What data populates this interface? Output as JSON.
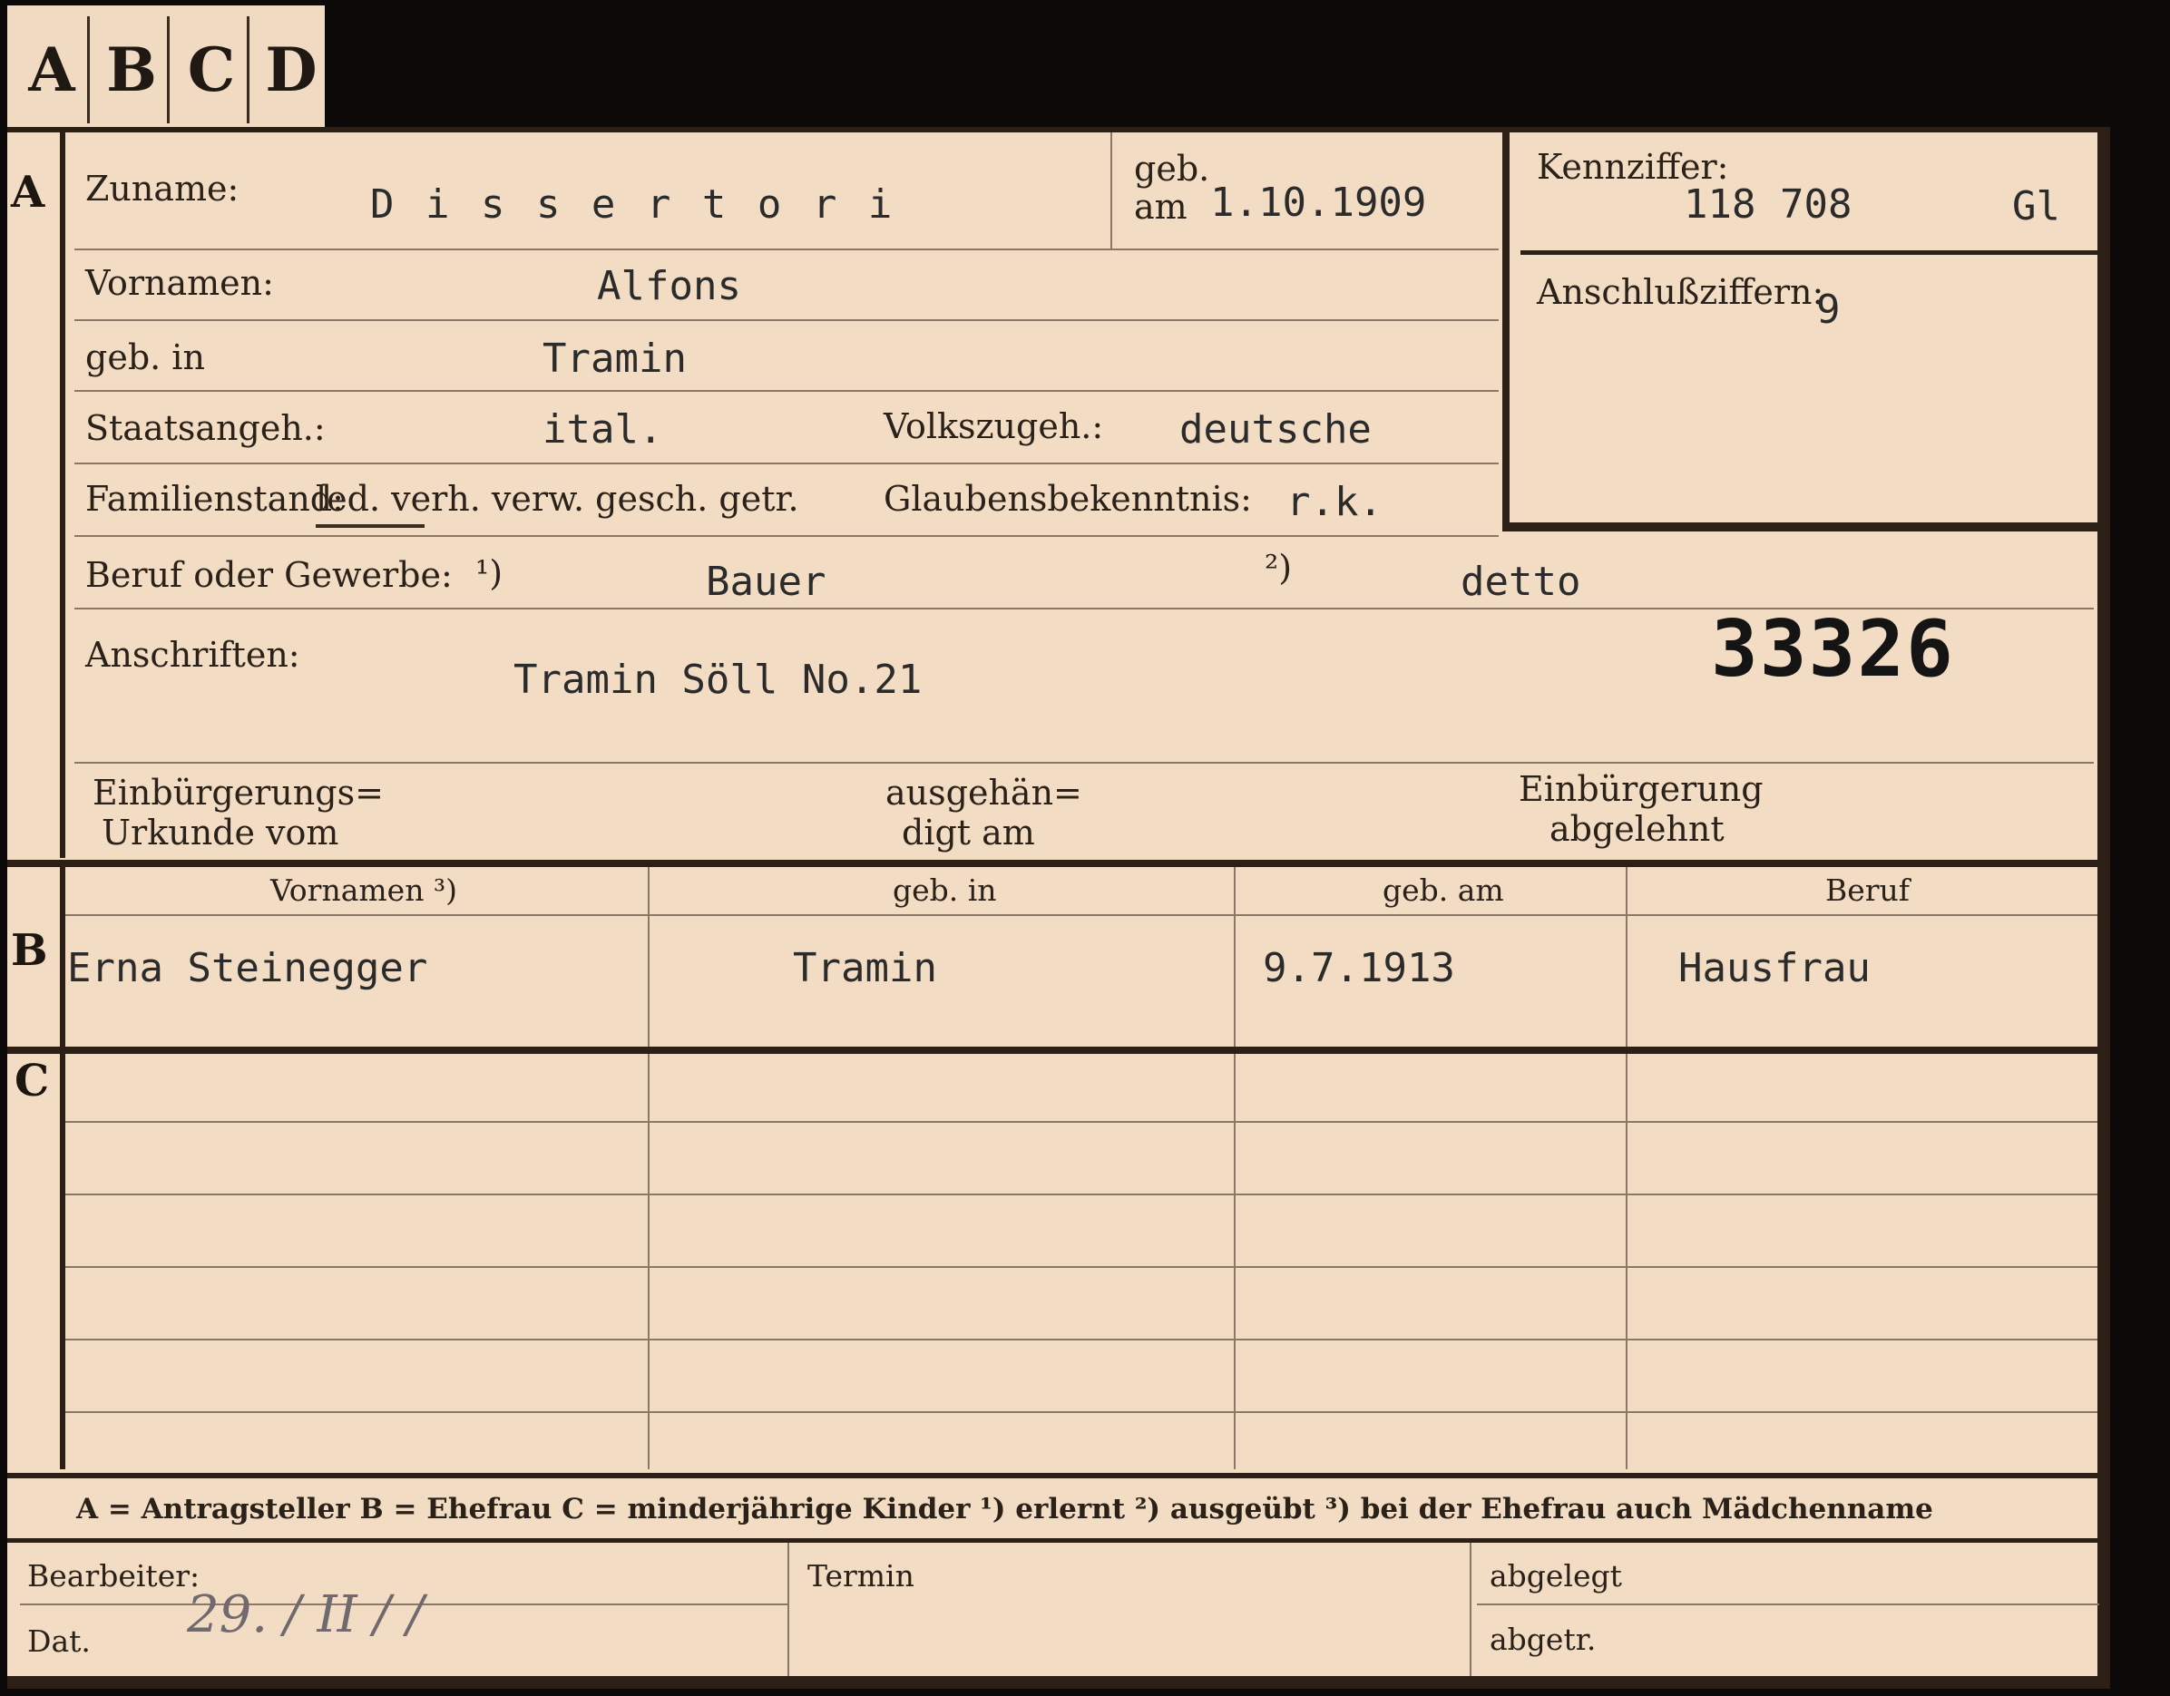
{
  "tabs": [
    "A",
    "B",
    "C",
    "D"
  ],
  "section_a": {
    "marker": "A",
    "zuname_label": "Zuname:",
    "zuname_value": "D i s s e r t o r i",
    "geb_label": "geb.",
    "am_label": "am",
    "geb_value": "1.10.1909",
    "vornamen_label": "Vornamen:",
    "vornamen_value": "Alfons",
    "geb_in_label": "geb. in",
    "geb_in_value": "Tramin",
    "staatsangeh_label": "Staatsangeh.:",
    "staatsangeh_value": "ital.",
    "volkszugeh_label": "Volkszugeh.:",
    "volkszugeh_value": "deutsche",
    "familienstand_label": "Familienstand:",
    "familienstand_options": "led. verh. verw. gesch. getr.",
    "glaubens_label": "Glaubensbekenntnis:",
    "glaubens_value": "r.k.",
    "beruf_label": "Beruf oder Gewerbe:",
    "beruf_note1": "¹)",
    "beruf_value1": "Bauer",
    "beruf_note2": "²)",
    "beruf_value2": "detto",
    "anschriften_label": "Anschriften:",
    "anschriften_value": "Tramin Söll No.21",
    "stamp_number": "33326",
    "einbuergerung_label_1": "Einbürgerungs=",
    "einbuergerung_label_2": "Urkunde vom",
    "ausgehaendigt_label_1": "ausgehän=",
    "ausgehaendigt_label_2": "digt am",
    "abgelehnt_label_1": "Einbürgerung",
    "abgelehnt_label_2": "abgelehnt"
  },
  "kennziffer": {
    "label": "Kennziffer:",
    "value": "118 708",
    "suffix": "Gl",
    "anschluss_label": "Anschlußziffern:",
    "anschluss_value": "9"
  },
  "section_b": {
    "marker": "B",
    "headers": [
      "Vornamen ³)",
      "geb. in",
      "geb. am",
      "Beruf"
    ],
    "row": [
      "Erna Steinegger",
      "Tramin",
      "9.7.1913",
      "Hausfrau"
    ]
  },
  "section_c": {
    "marker": "C"
  },
  "legend": "A = Antragsteller   B = Ehefrau   C = minderjährige Kinder   ¹) erlernt   ²) ausgeübt   ³) bei der Ehefrau auch Mädchenname",
  "footer": {
    "bearbeiter_label": "Bearbeiter:",
    "dat_label": "Dat.",
    "dat_value": "29. / II /   /",
    "termin_label": "Termin",
    "abgelegt_label": "abgelegt",
    "abgetr_label": "abgetr."
  },
  "colors": {
    "paper": "#f2dcc4",
    "ink": "#231c16",
    "background": "#0c0a08"
  }
}
